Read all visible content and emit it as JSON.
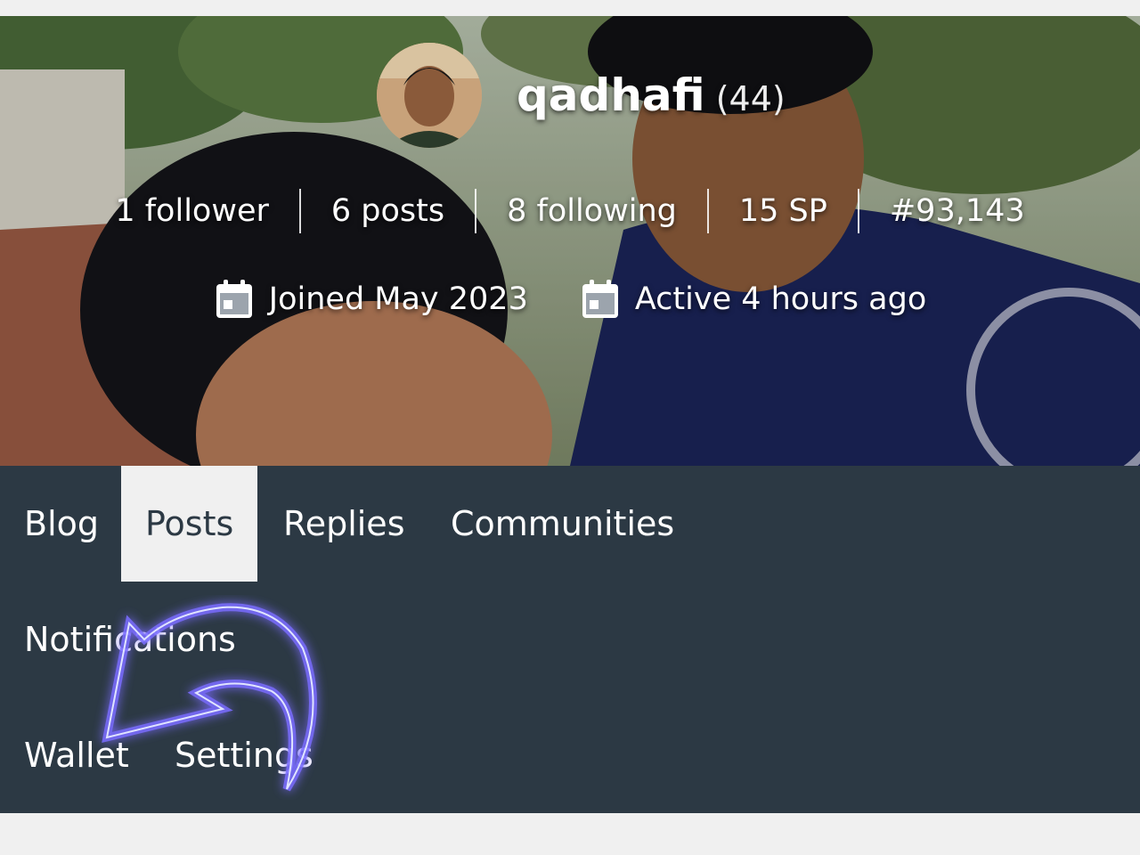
{
  "profile": {
    "username": "qadhafi",
    "reputation": "(44)"
  },
  "stats": [
    {
      "label": "1 follower"
    },
    {
      "label": "6 posts"
    },
    {
      "label": "8 following"
    },
    {
      "label": "15 SP"
    },
    {
      "label": "#93,143"
    }
  ],
  "meta": {
    "joined": "Joined May 2023",
    "active": "Active 4 hours ago"
  },
  "tabs": {
    "blog": "Blog",
    "posts": "Posts",
    "replies": "Replies",
    "communities": "Communities",
    "notifications": "Notifications",
    "wallet": "Wallet",
    "settings": "Settings"
  },
  "active_tab": "posts",
  "colors": {
    "nav_background": "#2c3944",
    "active_tab_background": "#f0f0f0",
    "arrow_glow": "#6a5cff"
  }
}
